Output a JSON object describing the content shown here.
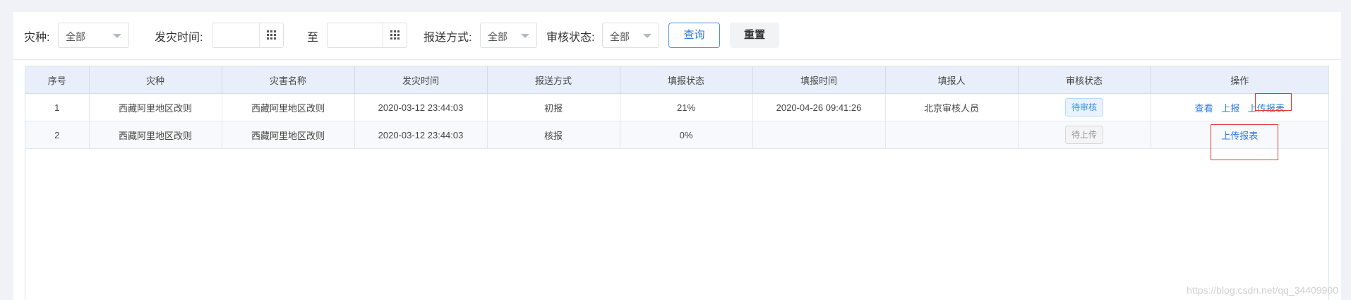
{
  "filters": {
    "disaster_type_label": "灾种:",
    "disaster_type_value": "全部",
    "time_label": "发灾时间:",
    "time_start": "",
    "time_to": "至",
    "time_end": "",
    "report_method_label": "报送方式:",
    "report_method_value": "全部",
    "review_status_label": "审核状态:",
    "review_status_value": "全部",
    "query_button": "查询",
    "reset_button": "重置"
  },
  "table": {
    "columns": [
      "序号",
      "灾种",
      "灾害名称",
      "发灾时间",
      "报送方式",
      "填报状态",
      "填报时间",
      "填报人",
      "审核状态",
      "操作"
    ],
    "rows": [
      {
        "index": "1",
        "type": "西藏阿里地区改则",
        "name": "西藏阿里地区改则",
        "occur_time": "2020-03-12 23:44:03",
        "method": "初报",
        "fill_status": "21%",
        "fill_time": "2020-04-26 09:41:26",
        "filler": "北京审核人员",
        "review_status": "待审核",
        "actions": [
          "查看",
          "上报",
          "上传报表"
        ]
      },
      {
        "index": "2",
        "type": "西藏阿里地区改则",
        "name": "西藏阿里地区改则",
        "occur_time": "2020-03-12 23:44:03",
        "method": "核报",
        "fill_status": "0%",
        "fill_time": "",
        "filler": "",
        "review_status": "待上传",
        "actions": [
          "上传报表"
        ]
      }
    ]
  },
  "watermark": "https://blog.csdn.net/qq_34409900",
  "colors": {
    "accent": "#2f7be0",
    "header_bg": "#e8effa",
    "highlight": "#e53935"
  }
}
